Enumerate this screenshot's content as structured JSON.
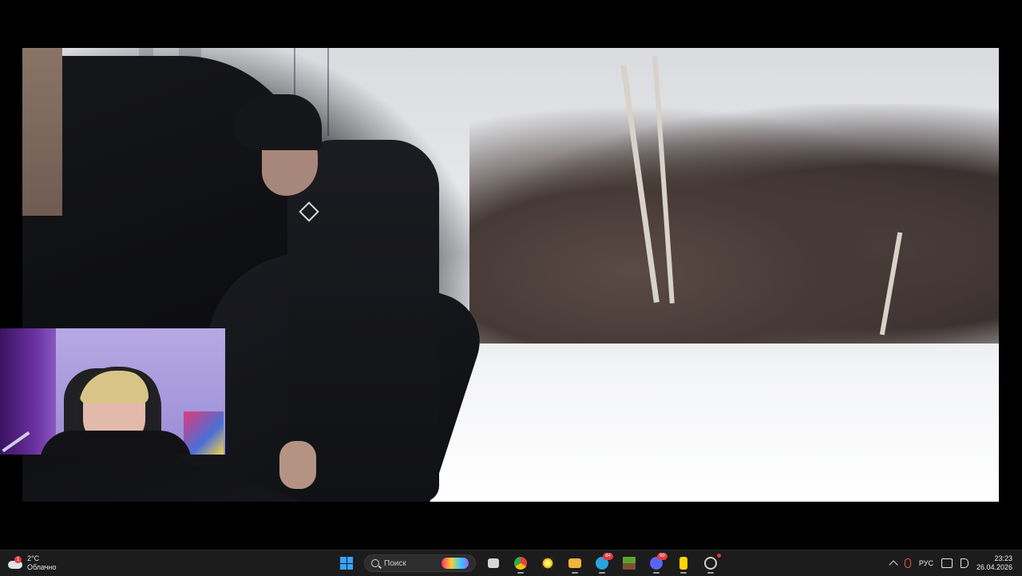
{
  "video": {
    "description": ""
  },
  "taskbar": {
    "weather": {
      "temperature": "2°C",
      "condition": "Облачно",
      "badge": "1"
    },
    "search": {
      "placeholder": "Поиск"
    },
    "apps": [
      {
        "name": "task-view",
        "color": "#d6d6d6",
        "badge": ""
      },
      {
        "name": "chrome",
        "color": "#e84335",
        "badge": ""
      },
      {
        "name": "solar-app",
        "color": "#f4c20d",
        "badge": ""
      },
      {
        "name": "file-explorer",
        "color": "#f2b43a",
        "badge": ""
      },
      {
        "name": "telegram",
        "color": "#2aa3e0",
        "badge": "84"
      },
      {
        "name": "minecraft",
        "color": "#5da130",
        "badge": ""
      },
      {
        "name": "discord",
        "color": "#5865f2",
        "badge": "99"
      },
      {
        "name": "yellow-app",
        "color": "#ffd400",
        "badge": ""
      },
      {
        "name": "obs",
        "color": "#cfcfcf",
        "badge": "•"
      }
    ],
    "tray": {
      "language": "РУС",
      "time": "23:23",
      "date": "26.04.2026"
    }
  }
}
